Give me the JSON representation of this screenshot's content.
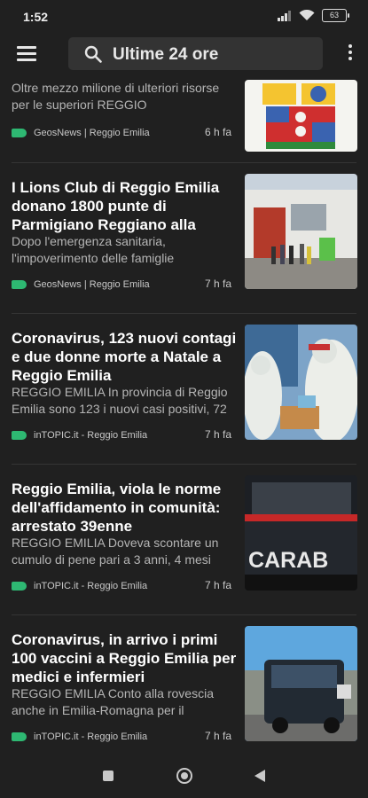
{
  "status": {
    "time": "1:52",
    "battery": "63"
  },
  "search": {
    "text": "Ultime 24 ore"
  },
  "articles": [
    {
      "headline": "",
      "snippet": "Oltre mezzo milione di ulteriori risorse per le superiori REGGIO",
      "source": "GeosNews | Reggio Emilia",
      "time": "6 h fa"
    },
    {
      "headline": "I Lions Club di Reggio Emilia donano 1800 punte di Parmigiano Reggiano alla",
      "snippet": "Dopo l'emergenza sanitaria, l'impoverimento delle famiglie",
      "source": "GeosNews | Reggio Emilia",
      "time": "7 h fa"
    },
    {
      "headline": "Coronavirus, 123 nuovi contagi e due donne morte a Natale a Reggio Emilia",
      "snippet": "REGGIO EMILIA In provincia di Reggio Emilia sono 123 i nuovi casi positivi, 72",
      "source": "inTOPIC.it - Reggio Emilia",
      "time": "7 h fa"
    },
    {
      "headline": "Reggio Emilia, viola le norme dell'affidamento in comunità: arrestato 39enne",
      "snippet": "REGGIO EMILIA  Doveva scontare un cumulo di pene pari a 3 anni, 4 mesi",
      "source": "inTOPIC.it - Reggio Emilia",
      "time": "7 h fa",
      "image_text": "CARAB"
    },
    {
      "headline": "Coronavirus, in arrivo i primi 100 vaccini a Reggio Emilia per medici e infermieri",
      "snippet": "REGGIO EMILIA Conto alla rovescia anche in Emilia-Romagna per il",
      "source": "inTOPIC.it - Reggio Emilia",
      "time": "7 h fa"
    }
  ],
  "colors": {
    "background": "#202020",
    "source_tag": "#2eb872"
  }
}
